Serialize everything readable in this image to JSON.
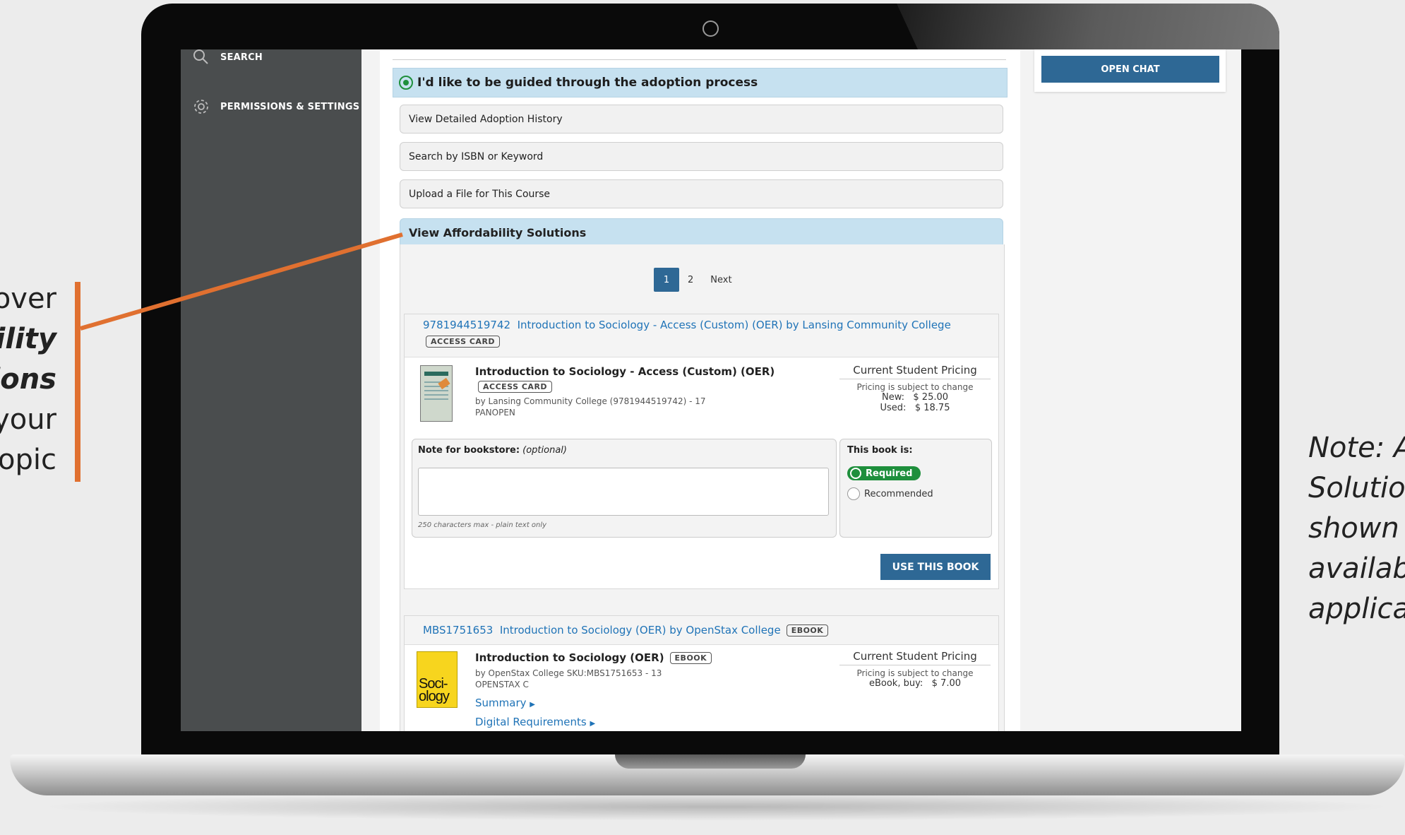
{
  "slide": {
    "left_callout": {
      "line1": "over",
      "line2": "bility",
      "line3": "ions",
      "line4": "your",
      "line5": "opic"
    },
    "right_note": {
      "line1": "Note: A",
      "line2": "Solutio",
      "line3": "shown",
      "line4": "availab",
      "line5": "applica"
    },
    "accent_color": "#e07030"
  },
  "sidebar": {
    "items": [
      {
        "label": "SEARCH",
        "icon": "search-icon"
      },
      {
        "label": "PERMISSIONS & SETTINGS",
        "icon": "gear-icon"
      }
    ]
  },
  "chat": {
    "button_label": "OPEN CHAT"
  },
  "adoption": {
    "option_label": "I'd like to be guided through the adoption process",
    "sections": [
      "View Detailed Adoption History",
      "Search by ISBN or Keyword",
      "Upload a File for This Course",
      "View Affordability Solutions"
    ]
  },
  "pagination": {
    "current": "1",
    "pages": [
      "2"
    ],
    "next_label": "Next"
  },
  "results": [
    {
      "header_link": "9781944519742  Introduction to Sociology - Access (Custom) (OER) by Lansing Community College",
      "header_tag": "ACCESS CARD",
      "title": "Introduction to Sociology - Access (Custom) (OER)",
      "tag": "ACCESS CARD",
      "byline": "by Lansing Community College (9781944519742) - 17",
      "publisher": "PANOPEN",
      "pricing_title": "Current Student Pricing",
      "pricing_note": "Pricing is subject to change",
      "prices": [
        {
          "label": "New:",
          "value": "$ 25.00"
        },
        {
          "label": "Used:",
          "value": "$ 18.75"
        }
      ],
      "note_label": "Note for bookstore:",
      "note_optional": "(optional)",
      "note_hint": "250 characters max - plain text only",
      "book_is_label": "This book is:",
      "required_label": "Required",
      "recommended_label": "Recommended",
      "use_button": "USE THIS BOOK"
    },
    {
      "header_link": "MBS1751653  Introduction to Sociology (OER) by OpenStax College",
      "header_tag": "EBOOK",
      "title": "Introduction to Sociology (OER)",
      "tag": "EBOOK",
      "byline": "by OpenStax College SKU:MBS1751653 - 13",
      "publisher": "OPENSTAX C",
      "summary_link": "Summary",
      "digital_link": "Digital Requirements",
      "cover_text": "Soci-ology",
      "pricing_title": "Current Student Pricing",
      "pricing_note": "Pricing is subject to change",
      "prices": [
        {
          "label": "eBook, buy:",
          "value": "$ 7.00"
        }
      ]
    }
  ]
}
